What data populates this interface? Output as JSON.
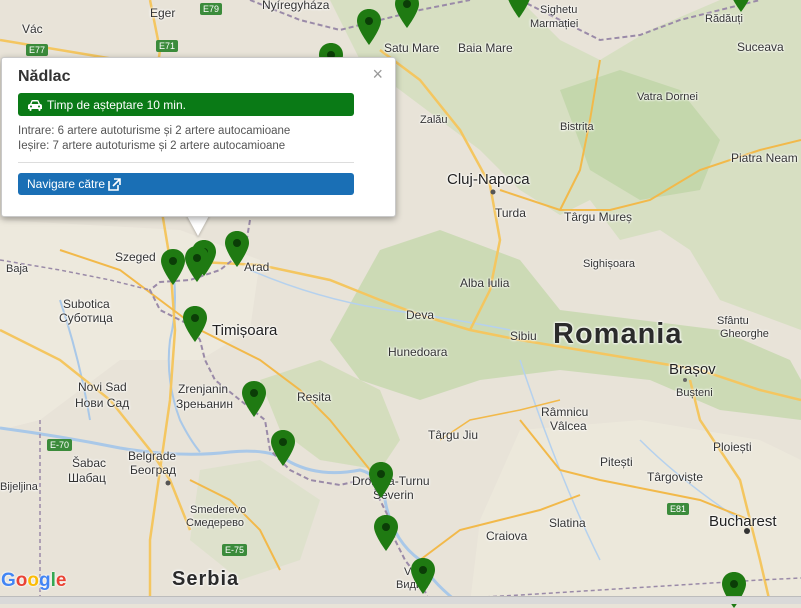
{
  "popup": {
    "title": "Nădlac",
    "wait_text": "Timp de așteptare 10 min.",
    "entry_text": "Intrare: 6 artere autoturisme și 2 artere autocamioane",
    "exit_text": "Ieșire: 7 artere autoturisme și 2 artere autocamioane",
    "nav_label": "Navigare către",
    "close_symbol": "×",
    "wait_color": "#0a7a16",
    "nav_color": "#1a6fb5"
  },
  "map": {
    "attribution": "Google",
    "countries": {
      "romania": "Romania",
      "serbia": "Serbia"
    },
    "cities": {
      "eger": "Eger",
      "nyiregyhaza": "Nyíregyháza",
      "sighetu": "Sighetu",
      "marmatiei": "Marmației",
      "radauti": "Rădăuți",
      "satu_mare": "Satu Mare",
      "baia_mare": "Baia Mare",
      "suceava": "Suceava",
      "vac": "Vác",
      "vatra_dornei": "Vatra Dornei",
      "zalau": "Zalău",
      "bistrita": "Bistrița",
      "piatra_neamt": "Piatra Neam",
      "cluj": "Cluj-Napoca",
      "turda": "Turda",
      "targu_mures": "Târgu Mureș",
      "szeged": "Szeged",
      "arad": "Arad",
      "baja": "Baja",
      "sighisoara": "Sighișoara",
      "alba_iulia": "Alba Iulia",
      "subotica": "Subotica",
      "subotica_cyr": "Суботица",
      "timisoara": "Timișoara",
      "deva": "Deva",
      "sibiu": "Sibiu",
      "sfantu": "Sfântu",
      "gheorghe": "Gheorghe",
      "hunedoara": "Hunedoara",
      "brasov": "Brașov",
      "novi_sad": "Novi Sad",
      "novi_sad_cyr": "Нови Сад",
      "zrenjanin": "Zrenjanin",
      "zrenjanin_cyr": "Зрењанин",
      "resita": "Reșita",
      "busteni": "Bușteni",
      "ramnicu": "Râmnicu",
      "valcea": "Vâlcea",
      "targu_jiu": "Târgu Jiu",
      "ploiesti": "Ploiești",
      "belgrade": "Belgrade",
      "belgrade_cyr": "Београд",
      "sabac": "Šabac",
      "sabac_cyr": "Шабац",
      "pitesti": "Pitești",
      "targoviste": "Târgoviște",
      "bijeljina": "Bijeljina",
      "drobeta": "Drobeta-Turnu",
      "severin": "Severin",
      "smederevo": "Smederevo",
      "smederevo_cyr": "Смедерево",
      "slatina": "Slatina",
      "bucharest": "Bucharest",
      "craiova": "Craiova",
      "vidin": "Видин",
      "vidin_v": "V"
    },
    "roads": {
      "e77": "E77",
      "e79": "E79",
      "e71": "E71",
      "e70": "E-70",
      "e75": "E-75",
      "e81": "E81"
    },
    "pin_color": "#1f7a12",
    "marker_count": 17
  }
}
